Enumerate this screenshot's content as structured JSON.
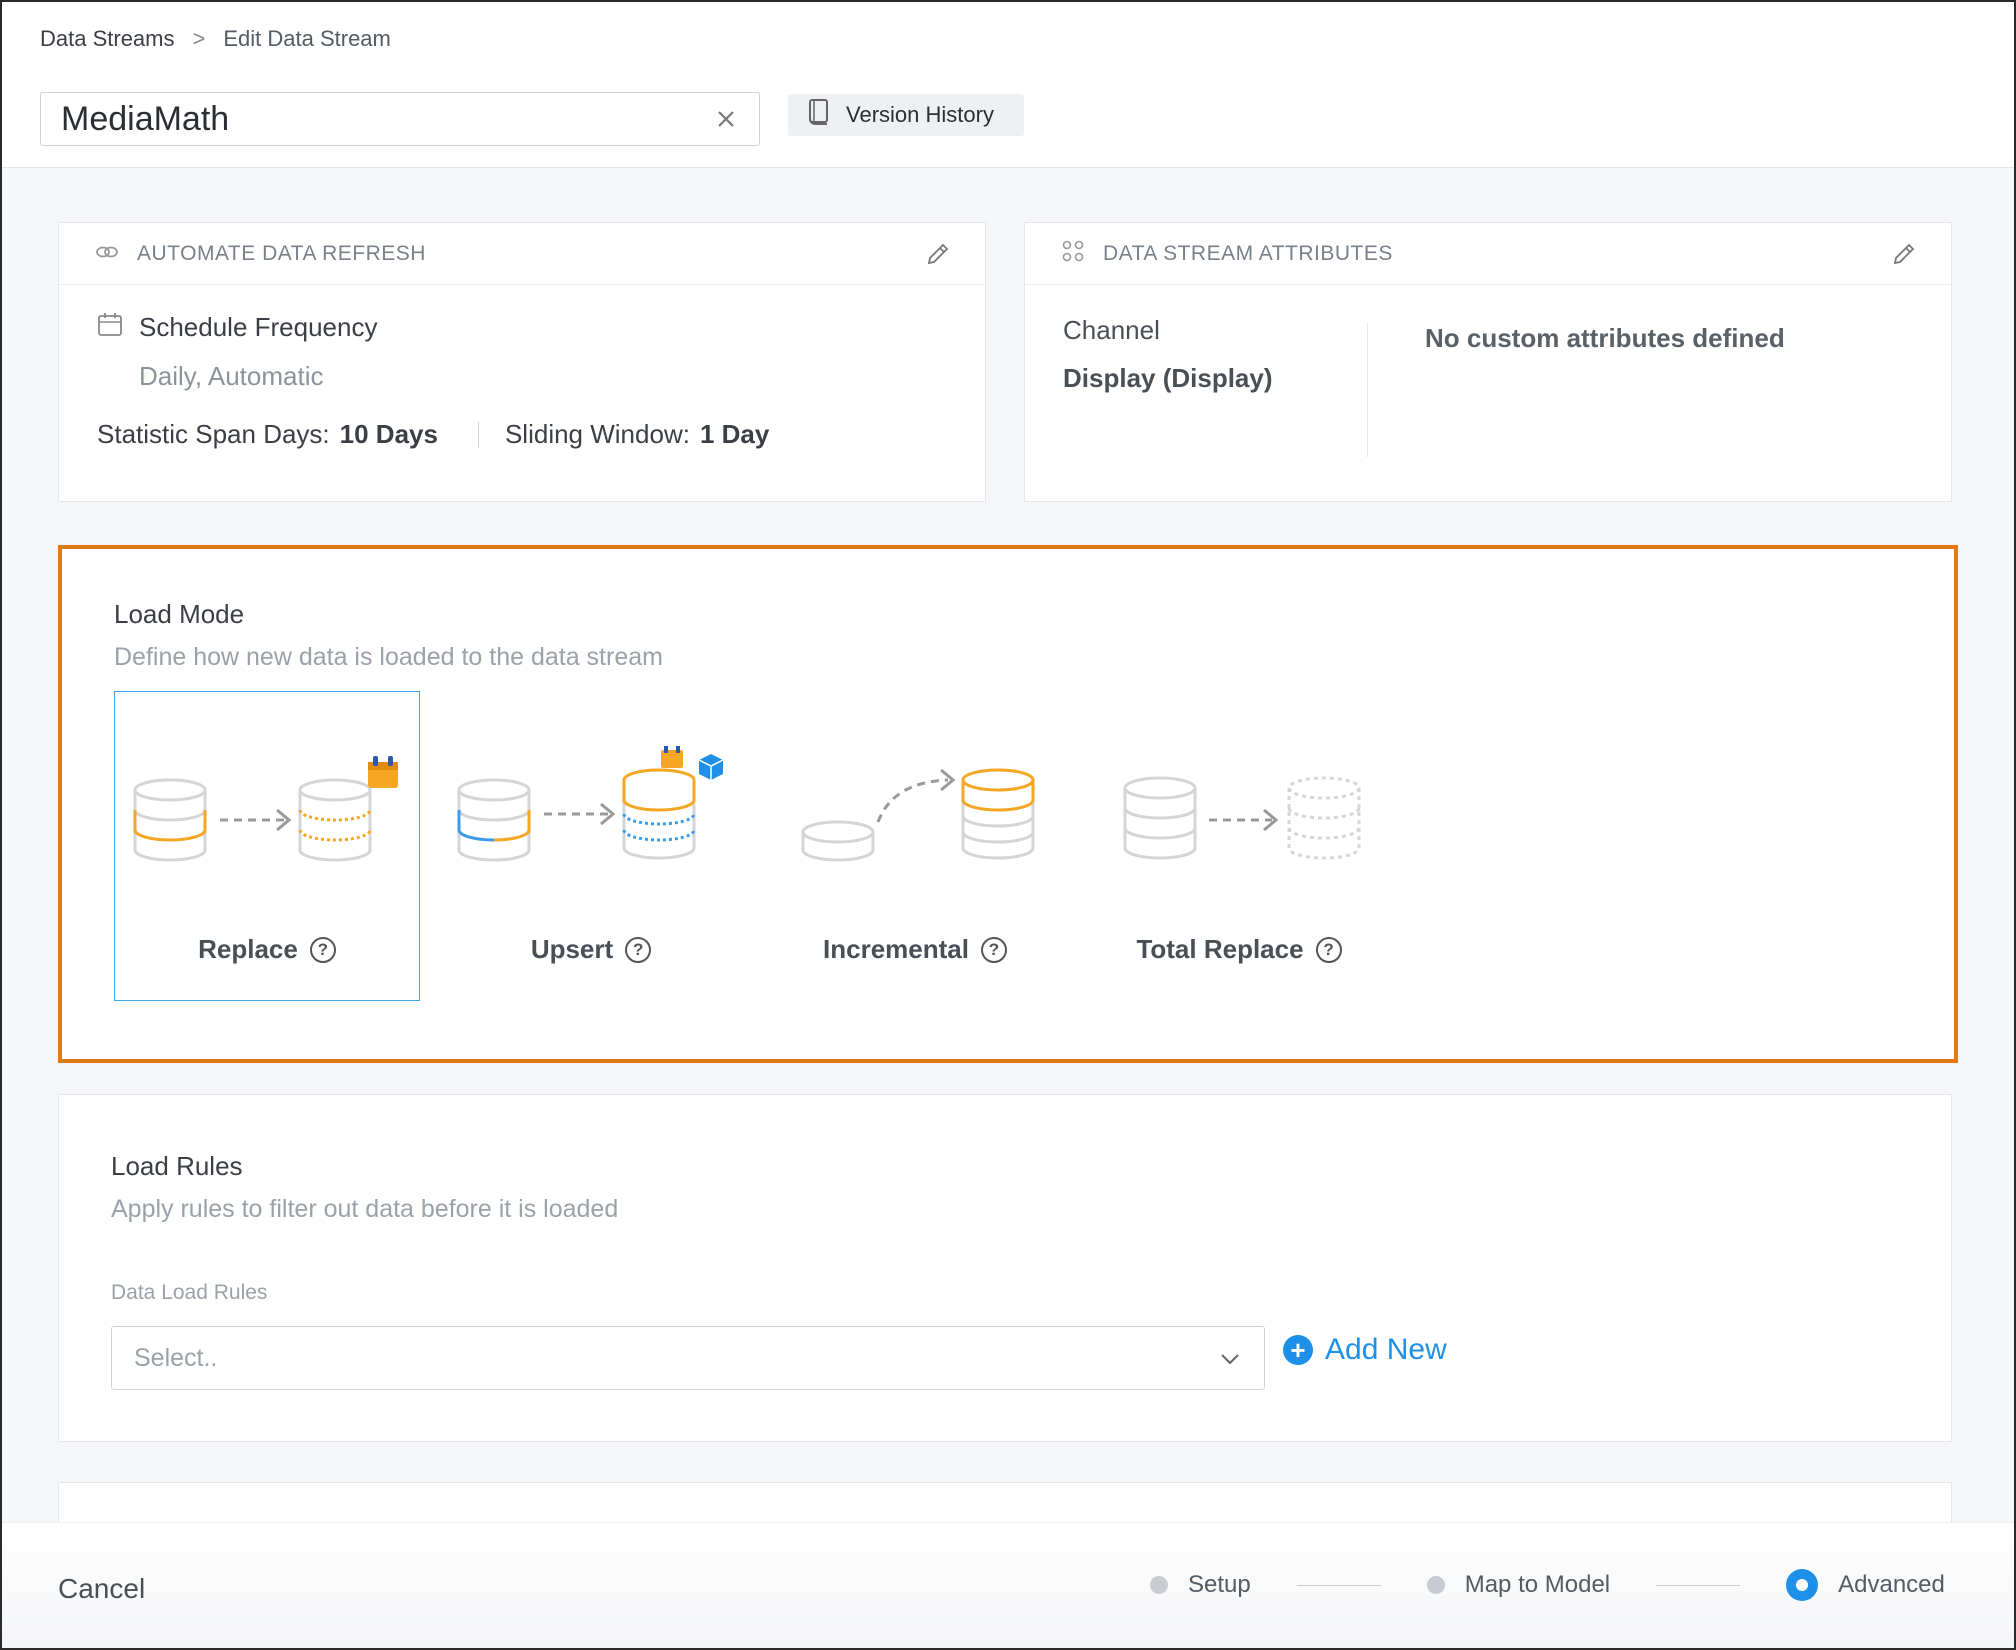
{
  "breadcrumb": {
    "root": "Data Streams",
    "separator": ">",
    "current": "Edit Data Stream"
  },
  "stream_name": {
    "value": "MediaMath"
  },
  "version_history": {
    "label": "Version History"
  },
  "refresh_card": {
    "title": "AUTOMATE DATA REFRESH",
    "schedule_label": "Schedule Frequency",
    "schedule_value": "Daily,  Automatic",
    "span_label": "Statistic Span Days:",
    "span_value": "10 Days",
    "window_label": "Sliding Window:",
    "window_value": "1 Day"
  },
  "attr_card": {
    "title": "DATA STREAM ATTRIBUTES",
    "channel_label": "Channel",
    "channel_value": "Display (Display)",
    "custom_attrs": "No custom attributes defined"
  },
  "load_mode": {
    "title": "Load Mode",
    "subtitle": "Define how new data is loaded to the data stream",
    "selected": "Replace",
    "options": [
      {
        "label": "Replace",
        "help": "?"
      },
      {
        "label": "Upsert",
        "help": "?"
      },
      {
        "label": "Incremental",
        "help": "?"
      },
      {
        "label": "Total Replace",
        "help": "?"
      }
    ]
  },
  "load_rules": {
    "title": "Load Rules",
    "subtitle": "Apply rules to filter out data before it is loaded",
    "field_label": "Data Load Rules",
    "select_placeholder": "Select..",
    "add_new": "Add New"
  },
  "footer": {
    "cancel": "Cancel",
    "steps": [
      {
        "label": "Setup",
        "active": false
      },
      {
        "label": "Map to Model",
        "active": false
      },
      {
        "label": "Advanced",
        "active": true
      }
    ]
  },
  "colors": {
    "accent": "#1e90e8",
    "highlight_border": "#e07b14",
    "orange": "#f5a623",
    "blue": "#3a9be8"
  }
}
